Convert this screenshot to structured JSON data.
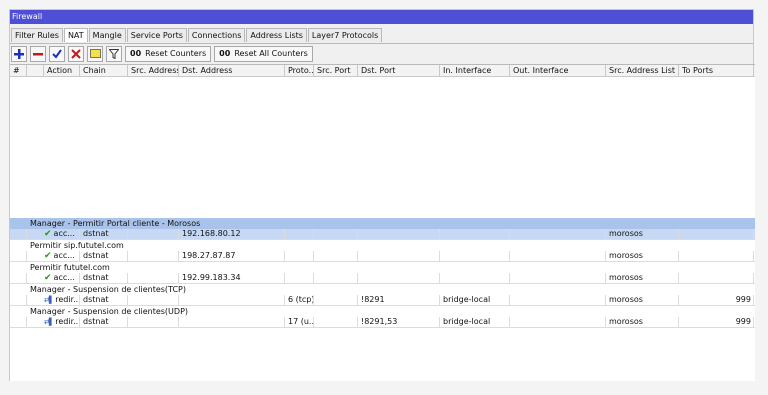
{
  "window": {
    "title": "Firewall"
  },
  "tabs": [
    "Filter Rules",
    "NAT",
    "Mangle",
    "Service Ports",
    "Connections",
    "Address Lists",
    "Layer7 Protocols"
  ],
  "active_tab": "NAT",
  "toolbar": {
    "reset_counters": "Reset Counters",
    "reset_all_counters": "Reset All Counters",
    "counter_prefix": "00"
  },
  "columns": [
    "#",
    "",
    "Action",
    "Chain",
    "Src. Address",
    "Dst. Address",
    "Proto...",
    "Src. Port",
    "Dst. Port",
    "In. Interface",
    "Out. Interface",
    "Src. Address List",
    "To Ports"
  ],
  "rules": [
    {
      "comment": "Manager - Permitir Portal cliente - Morosos",
      "action": "acc...",
      "action_type": "accept",
      "chain": "dstnat",
      "src": "",
      "dst": "192.168.80.12",
      "proto": "",
      "src_port": "",
      "dst_port": "",
      "in_if": "",
      "out_if": "",
      "src_list": "morosos",
      "to_ports": "",
      "selected": true
    },
    {
      "comment": "Permitir sip.fututel.com",
      "action": "acc...",
      "action_type": "accept",
      "chain": "dstnat",
      "src": "",
      "dst": "198.27.87.87",
      "proto": "",
      "src_port": "",
      "dst_port": "",
      "in_if": "",
      "out_if": "",
      "src_list": "morosos",
      "to_ports": "",
      "selected": false
    },
    {
      "comment": "Permitir fututel.com",
      "action": "acc...",
      "action_type": "accept",
      "chain": "dstnat",
      "src": "",
      "dst": "192.99.183.34",
      "proto": "",
      "src_port": "",
      "dst_port": "",
      "in_if": "",
      "out_if": "",
      "src_list": "morosos",
      "to_ports": "",
      "selected": false
    },
    {
      "comment": "Manager - Suspension de clientes(TCP)",
      "action": "redir...",
      "action_type": "redirect",
      "chain": "dstnat",
      "src": "",
      "dst": "",
      "proto": "6 (tcp)",
      "src_port": "",
      "dst_port": "!8291",
      "in_if": "bridge-local",
      "out_if": "",
      "src_list": "morosos",
      "to_ports": "999",
      "selected": false
    },
    {
      "comment": "Manager - Suspension de clientes(UDP)",
      "action": "redir...",
      "action_type": "redirect",
      "chain": "dstnat",
      "src": "",
      "dst": "",
      "proto": "17 (u...",
      "src_port": "",
      "dst_port": "!8291,53",
      "in_if": "bridge-local",
      "out_if": "",
      "src_list": "morosos",
      "to_ports": "999",
      "selected": false
    }
  ]
}
